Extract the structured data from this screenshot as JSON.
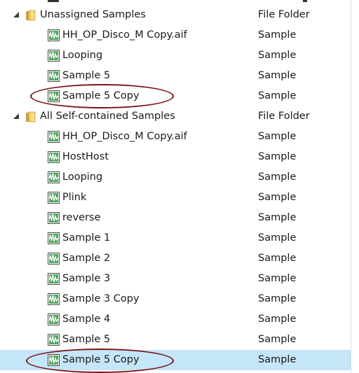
{
  "tree": {
    "groups": [
      {
        "name": "Unassigned Samples",
        "type": "File Folder",
        "items": [
          {
            "name": "HH_OP_Disco_M Copy.aif",
            "type": "Sample"
          },
          {
            "name": "Looping",
            "type": "Sample"
          },
          {
            "name": "Sample 5",
            "type": "Sample"
          },
          {
            "name": "Sample 5 Copy",
            "type": "Sample"
          }
        ]
      },
      {
        "name": "All Self-contained Samples",
        "type": "File Folder",
        "items": [
          {
            "name": "HH_OP_Disco_M Copy.aif",
            "type": "Sample"
          },
          {
            "name": "HostHost",
            "type": "Sample"
          },
          {
            "name": "Looping",
            "type": "Sample"
          },
          {
            "name": "Plink",
            "type": "Sample"
          },
          {
            "name": "reverse",
            "type": "Sample"
          },
          {
            "name": "Sample 1",
            "type": "Sample"
          },
          {
            "name": "Sample 2",
            "type": "Sample"
          },
          {
            "name": "Sample 3",
            "type": "Sample"
          },
          {
            "name": "Sample 3 Copy",
            "type": "Sample"
          },
          {
            "name": "Sample 4",
            "type": "Sample"
          },
          {
            "name": "Sample 5",
            "type": "Sample"
          },
          {
            "name": "Sample 5 Copy",
            "type": "Sample",
            "selected": true
          }
        ]
      }
    ],
    "highlight_color": "#c5e5f8",
    "annotation_color": "#7a1418"
  }
}
